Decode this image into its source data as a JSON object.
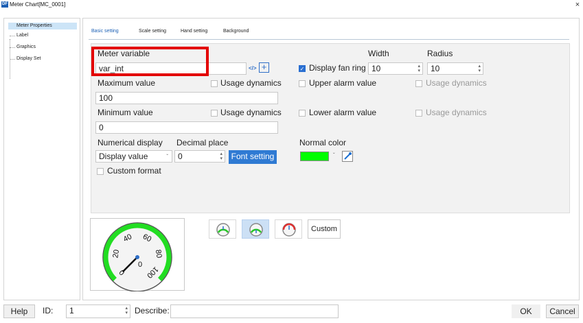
{
  "window": {
    "title": "Meter Chart[MC_0001]",
    "icon_text": "DF",
    "close_glyph": "×"
  },
  "tree": {
    "items": [
      {
        "label": "Meter Properties",
        "selected": true
      },
      {
        "label": "Label"
      },
      {
        "label": "Graphics"
      },
      {
        "label": "Display Set"
      }
    ]
  },
  "tabs": [
    {
      "label": "Basic setting",
      "active": true
    },
    {
      "label": "Scale setting"
    },
    {
      "label": "Hand setting"
    },
    {
      "label": "Background"
    }
  ],
  "basic": {
    "meter_variable_label": "Meter variable",
    "meter_variable_value": "var_int",
    "var_code_icon": "</>",
    "var_add_icon": "+",
    "width_header": "Width",
    "radius_header": "Radius",
    "display_fan_ring_label": "Display fan ring",
    "display_fan_ring_checked": true,
    "fan_width": "10",
    "fan_radius": "10",
    "max_label": "Maximum value",
    "max_value": "100",
    "usage_dynamics": "Usage dynamics",
    "upper_alarm_label": "Upper alarm value",
    "min_label": "Minimum value",
    "min_value": "0",
    "lower_alarm_label": "Lower alarm value",
    "numerical_display_label": "Numerical display",
    "decimal_place_label": "Decimal place",
    "numerical_display_value": "Display value",
    "decimal_place_value": "0",
    "font_setting_label": "Font setting",
    "normal_color_label": "Normal color",
    "normal_color": "#00ff00",
    "custom_format_label": "Custom format"
  },
  "preview": {
    "ticks": [
      "0",
      "20",
      "40",
      "60",
      "80",
      "100"
    ],
    "center_value": "0",
    "ring_color": "#22dd22"
  },
  "styles": {
    "custom_label": "Custom",
    "selected_index": 1
  },
  "footer": {
    "help_label": "Help",
    "id_label": "ID:",
    "id_value": "1",
    "describe_label": "Describe:",
    "describe_value": "",
    "ok_label": "OK",
    "cancel_label": "Cancel"
  }
}
